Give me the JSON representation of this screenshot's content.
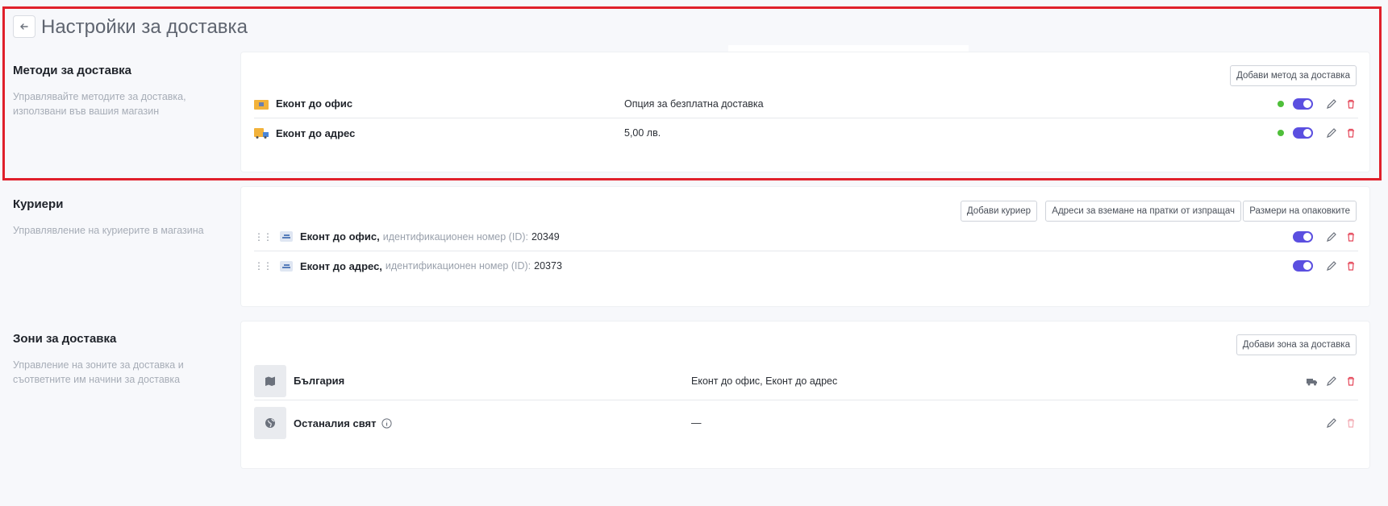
{
  "page": {
    "title": "Настройки за доставка",
    "back_icon": "arrow-left-icon"
  },
  "methods": {
    "title": "Методи за доставка",
    "description": "Управлявайте методите за доставка, използвани във вашия магазин",
    "add_button": "Добави метод за доставка",
    "items": [
      {
        "name": "Еконт до офис",
        "value": "Опция за безплатна доставка",
        "status": "active",
        "enabled": true
      },
      {
        "name": "Еконт до адрес",
        "value": "5,00 лв.",
        "status": "active",
        "enabled": true
      }
    ]
  },
  "couriers": {
    "title": "Куриери",
    "description": "Управлявление на куриерите в магазина",
    "buttons": {
      "add": "Добави куриер",
      "pickup": "Адреси за вземане на пратки от изпращач",
      "sizes": "Размери на опаковките"
    },
    "id_label": "идентификационен номер (ID):",
    "items": [
      {
        "name": "Еконт до офис,",
        "id": "20349",
        "enabled": true
      },
      {
        "name": "Еконт до адрес,",
        "id": "20373",
        "enabled": true
      }
    ]
  },
  "zones": {
    "title": "Зони за доставка",
    "description": "Управление на зоните за доставка и съответните им начини за доставка",
    "add_button": "Добави зона за доставка",
    "items": [
      {
        "name": "България",
        "methods": "Еконт до офис, Еконт до адрес",
        "icon": "map-icon"
      },
      {
        "name": "Останалия свят",
        "methods": "—",
        "icon": "globe-icon"
      }
    ]
  },
  "colors": {
    "accent": "#5b4fe0",
    "status_ok": "#4fbf3a",
    "danger": "#e5485a",
    "highlight": "#e0202b"
  }
}
